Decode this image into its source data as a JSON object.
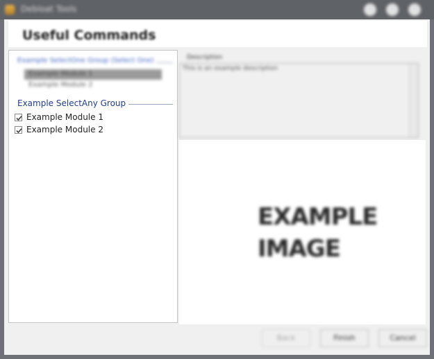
{
  "window": {
    "title": "Debloat Tools",
    "icon": "app-icon",
    "controls": [
      "minimize-icon",
      "maximize-icon",
      "close-icon"
    ]
  },
  "header": {
    "title": "Useful Commands"
  },
  "left_panel": {
    "select_one_group": {
      "title": "Example SelectOne Group (Select One)",
      "items": [
        {
          "label": "Example Module 1",
          "selected": true
        },
        {
          "label": "Example Module 2",
          "selected": false
        }
      ]
    },
    "select_any_group": {
      "title": "Example SelectAny Group",
      "items": [
        {
          "label": "Example Module 1",
          "checked": true
        },
        {
          "label": "Example Module 2",
          "checked": true
        }
      ]
    }
  },
  "description": {
    "caption": "Description",
    "text": "This is an example description"
  },
  "image": {
    "line1": "EXAMPLE",
    "line2": "IMAGE"
  },
  "buttons": {
    "back": {
      "label": "Back",
      "enabled": false
    },
    "finish": {
      "label": "Finish",
      "enabled": true
    },
    "cancel": {
      "label": "Cancel",
      "enabled": true
    }
  },
  "colors": {
    "titlebar": "#5f6266",
    "group_title": "#1f3d8f",
    "selected_item": "#9a9a9a"
  }
}
